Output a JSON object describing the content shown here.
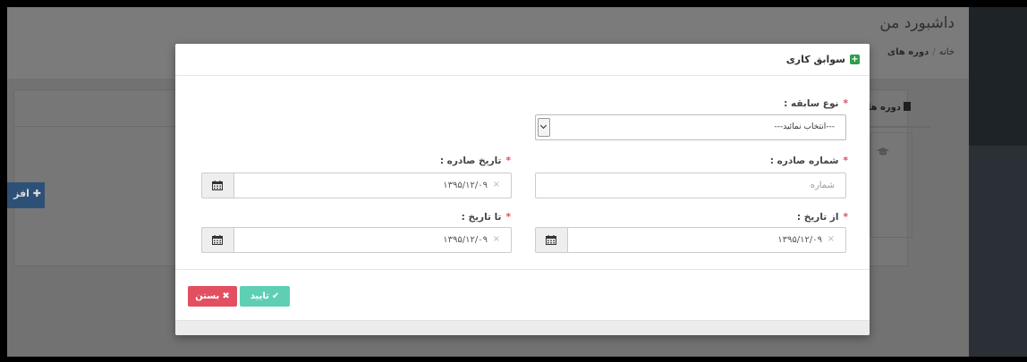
{
  "dashboard": {
    "title": "داشبورد من",
    "breadcrumb": [
      "خانه",
      "دوره های"
    ],
    "tab_label": "دوره های",
    "add_button": "افز"
  },
  "modal": {
    "title": "سوابق کاری",
    "fields": {
      "record_type": {
        "label": "نوع سابقه :",
        "selected": "---انتخاب نمائید---"
      },
      "issue_number": {
        "label": "شماره صادره :",
        "placeholder": "شماره"
      },
      "issue_date": {
        "label": "تاریخ صادره :",
        "value": "۱۳۹۵/۱۲/۰۹"
      },
      "from_date": {
        "label": "از تاریخ :",
        "value": "۱۳۹۵/۱۲/۰۹"
      },
      "to_date": {
        "label": "تا تاریخ :",
        "value": "۱۳۹۵/۱۲/۰۹"
      }
    },
    "buttons": {
      "confirm": "تایید",
      "close": "بستن"
    },
    "colors": {
      "confirm": "#5fcfb4",
      "close": "#e24f61",
      "required": "#e24a5c",
      "title_icon": "#2e9e4a"
    }
  },
  "icons": {
    "clear": "×",
    "check": "✔",
    "close": "✖",
    "required": "*"
  }
}
